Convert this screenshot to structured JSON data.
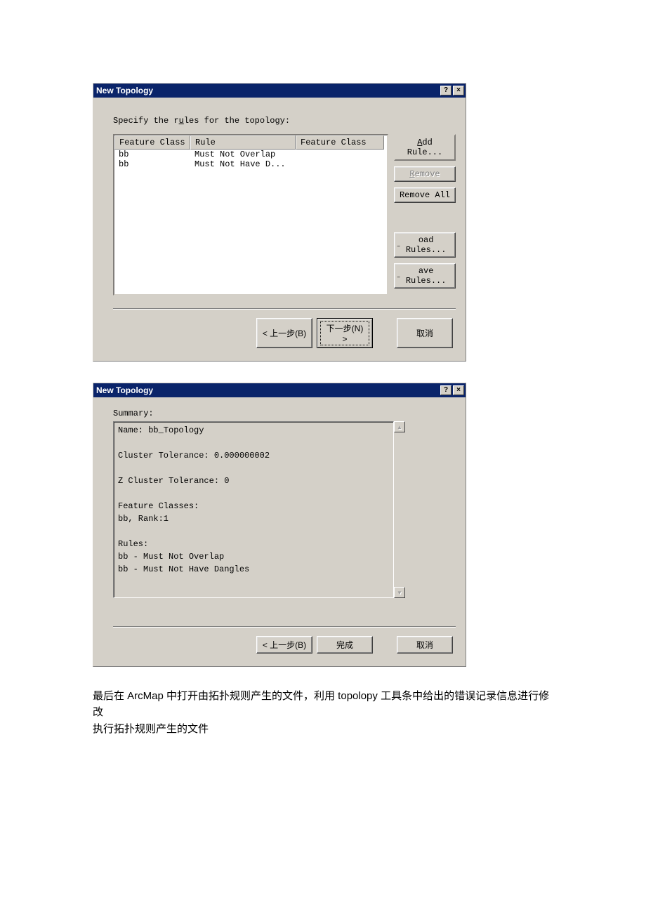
{
  "dialog1": {
    "title": "New Topology",
    "instruction_pre": "Specify the r",
    "instruction_u": "u",
    "instruction_post": "les for the topology:",
    "columns": {
      "fc1": "Feature Class",
      "rule": "Rule",
      "fc2": "Feature Class"
    },
    "rows": [
      {
        "fc1": "bb",
        "rule": "Must Not Overlap",
        "fc2": ""
      },
      {
        "fc1": "bb",
        "rule": "Must Not Have D...",
        "fc2": ""
      }
    ],
    "buttons": {
      "add_rule_u": "A",
      "add_rule_rest": "dd Rule...",
      "remove_u": "R",
      "remove_rest": "emove",
      "remove_all": "Remove All",
      "load_rules": "oad Rules...",
      "save_rules": "ave Rules..."
    },
    "footer": {
      "back": "< 上一步(B)",
      "next": "下一步(N) >",
      "cancel": "取消"
    }
  },
  "dialog2": {
    "title": "New Topology",
    "summary_label": "Summary:",
    "summary_text": "Name: bb_Topology\n\nCluster Tolerance: 0.000000002\n\nZ Cluster Tolerance: 0\n\nFeature Classes:\nbb, Rank:1\n\nRules:\nbb - Must Not Overlap\nbb - Must Not Have Dangles",
    "footer": {
      "back": "< 上一步(B)",
      "finish": "完成",
      "cancel": "取消"
    }
  },
  "doc": {
    "line1": "最后在 ArcMap 中打开由拓扑规则产生的文件，利用 topolopy 工具条中给出的错误记录信息进行修改",
    "line2": "执行拓扑规则产生的文件"
  }
}
